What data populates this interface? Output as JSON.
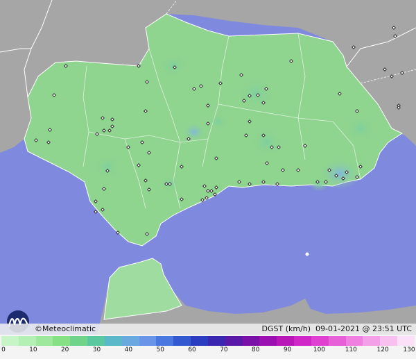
{
  "footer": {
    "credit": "©Meteoclimatic",
    "variable": "DGST (km/h)",
    "date": "09-01-2021",
    "time_sep": "@",
    "time": "23:51 UTC"
  },
  "legend": {
    "ticks": [
      "0",
      "10",
      "20",
      "30",
      "40",
      "50",
      "60",
      "70",
      "80",
      "90",
      "100",
      "110",
      "120",
      "130"
    ],
    "colors": [
      "#c8f5c8",
      "#b4f0b4",
      "#9ee89e",
      "#86e086",
      "#6fd48a",
      "#5cc8a0",
      "#5ab8c8",
      "#6aa8e0",
      "#6a94e8",
      "#4a78e0",
      "#3458d0",
      "#2a3cc0",
      "#3a26b0",
      "#5a18a8",
      "#7a10a8",
      "#9a10b0",
      "#b818b8",
      "#d028c8",
      "#e040d0",
      "#e860d8",
      "#f080e0",
      "#f4a0e8",
      "#f8c0f0",
      "#fce0f8"
    ]
  },
  "map": {
    "colors": {
      "sea": "#7f8ade",
      "land_outside": "#a6a6a6",
      "region": "#8fd48f",
      "region_highlight": "#9fdc9f",
      "border": "#ffffff",
      "station": "#1a1a1a"
    }
  }
}
